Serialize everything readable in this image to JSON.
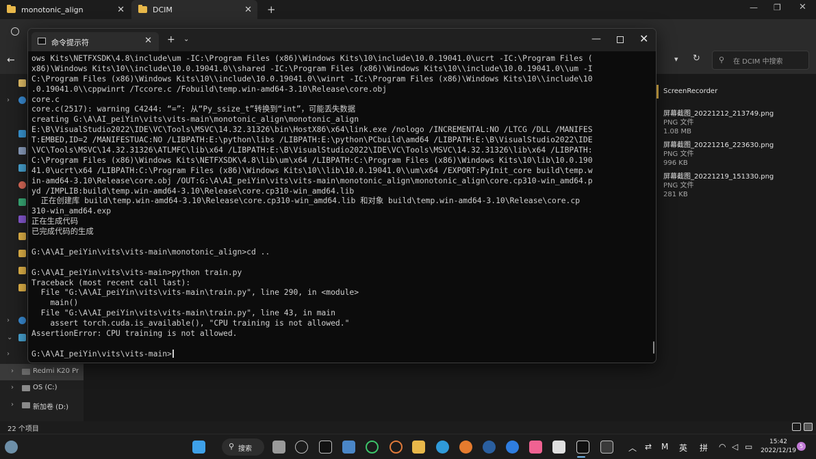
{
  "explorer": {
    "tabs": [
      {
        "label": "monotonic_align"
      },
      {
        "label": "DCIM"
      }
    ],
    "search": {
      "placeholder": "在 DCIM 中搜索"
    },
    "sidebar": {
      "drives": [
        {
          "label": "Redmi K20 Pr"
        },
        {
          "label": "OS (C:)"
        },
        {
          "label": "新加卷 (D:)"
        }
      ]
    },
    "files": {
      "folder": {
        "name": "ScreenRecorder"
      },
      "items": [
        {
          "name": "屏幕截图_20221212_213749.png",
          "type": "PNG 文件",
          "size": "1.08 MB"
        },
        {
          "name": "屏幕截图_20221216_223630.png",
          "type": "PNG 文件",
          "size": "996 KB"
        },
        {
          "name": "屏幕截图_20221219_151330.png",
          "type": "PNG 文件",
          "size": "281 KB"
        }
      ]
    },
    "status": {
      "count": "22 个项目"
    }
  },
  "terminal": {
    "tab_title": "命令提示符",
    "lines": [
      "ows Kits\\NETFXSDK\\4.8\\include\\um -IC:\\Program Files (x86)\\Windows Kits\\10\\include\\10.0.19041.0\\ucrt -IC:\\Program Files (",
      "x86)\\Windows Kits\\10\\\\include\\10.0.19041.0\\\\shared -IC:\\Program Files (x86)\\Windows Kits\\10\\\\include\\10.0.19041.0\\\\um -I",
      "C:\\Program Files (x86)\\Windows Kits\\10\\\\include\\10.0.19041.0\\\\winrt -IC:\\Program Files (x86)\\Windows Kits\\10\\\\include\\10",
      ".0.19041.0\\\\cppwinrt /Tccore.c /Fobuild\\temp.win-amd64-3.10\\Release\\core.obj",
      "core.c",
      "core.c(2517): warning C4244: “=”: 从“Py_ssize_t”转换到“int”，可能丢失数据",
      "creating G:\\A\\AI_peiYin\\vits\\vits-main\\monotonic_align\\monotonic_align",
      "E:\\B\\VisualStudio2022\\IDE\\VC\\Tools\\MSVC\\14.32.31326\\bin\\HostX86\\x64\\link.exe /nologo /INCREMENTAL:NO /LTCG /DLL /MANIFES",
      "T:EMBED,ID=2 /MANIFESTUAC:NO /LIBPATH:E:\\python\\libs /LIBPATH:E:\\python\\PCbuild\\amd64 /LIBPATH:E:\\B\\VisualStudio2022\\IDE",
      "\\VC\\Tools\\MSVC\\14.32.31326\\ATLMFC\\lib\\x64 /LIBPATH:E:\\B\\VisualStudio2022\\IDE\\VC\\Tools\\MSVC\\14.32.31326\\lib\\x64 /LIBPATH:",
      "C:\\Program Files (x86)\\Windows Kits\\NETFXSDK\\4.8\\lib\\um\\x64 /LIBPATH:C:\\Program Files (x86)\\Windows Kits\\10\\lib\\10.0.190",
      "41.0\\ucrt\\x64 /LIBPATH:C:\\Program Files (x86)\\Windows Kits\\10\\\\lib\\10.0.19041.0\\\\um\\x64 /EXPORT:PyInit_core build\\temp.w",
      "in-amd64-3.10\\Release\\core.obj /OUT:G:\\A\\AI_peiYin\\vits\\vits-main\\monotonic_align\\monotonic_align\\core.cp310-win_amd64.p",
      "yd /IMPLIB:build\\temp.win-amd64-3.10\\Release\\core.cp310-win_amd64.lib",
      "  正在创建库 build\\temp.win-amd64-3.10\\Release\\core.cp310-win_amd64.lib 和对象 build\\temp.win-amd64-3.10\\Release\\core.cp",
      "310-win_amd64.exp",
      "正在生成代码",
      "已完成代码的生成",
      "",
      "G:\\A\\AI_peiYin\\vits\\vits-main\\monotonic_align>cd ..",
      "",
      "G:\\A\\AI_peiYin\\vits\\vits-main>python train.py",
      "Traceback (most recent call last):",
      "  File \"G:\\A\\AI_peiYin\\vits\\vits-main\\train.py\", line 290, in <module>",
      "    main()",
      "  File \"G:\\A\\AI_peiYin\\vits\\vits-main\\train.py\", line 43, in main",
      "    assert torch.cuda.is_available(), \"CPU training is not allowed.\"",
      "AssertionError: CPU training is not allowed.",
      "",
      "G:\\A\\AI_peiYin\\vits\\vits-main>"
    ]
  },
  "taskbar": {
    "search_label": "搜索",
    "ime_lang": "英",
    "ime_mode": "拼",
    "time": "15:42",
    "date": "2022/12/19",
    "notification_count": "5"
  }
}
